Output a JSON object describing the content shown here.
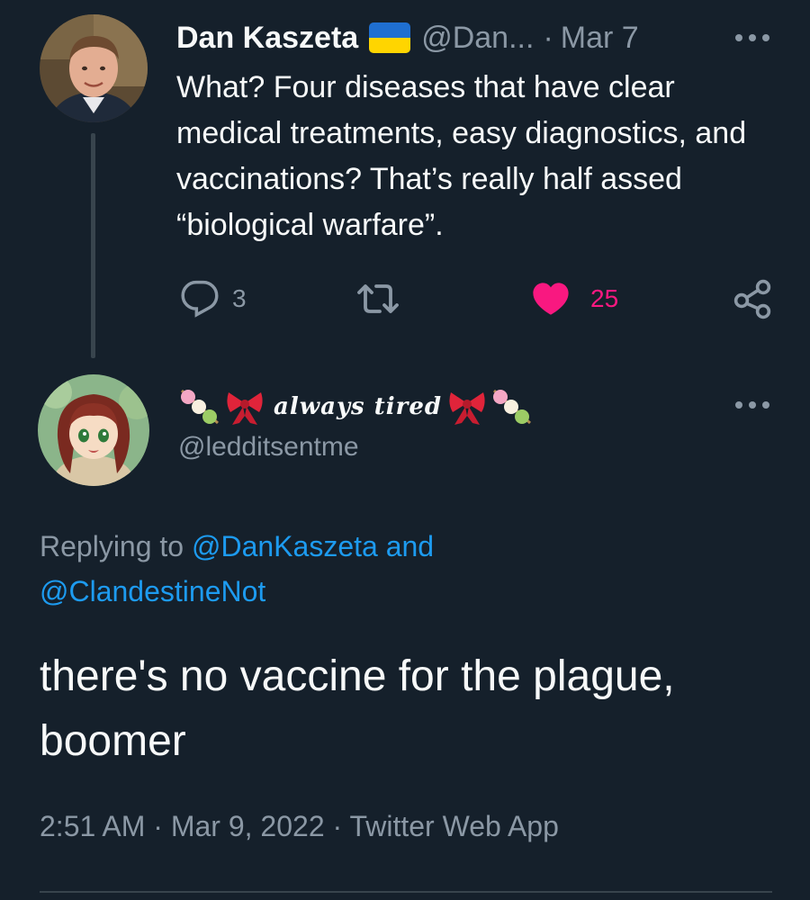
{
  "parent_tweet": {
    "author_name": "Dan Kaszeta",
    "flag_icon": "ukraine-flag-icon",
    "handle": "@Dan...",
    "separator": "·",
    "date": "Mar 7",
    "text": "What? Four diseases that have clear medical treatments, easy diagnostics, and vaccinations? That’s really half assed “biological warfare”.",
    "actions": {
      "reply_count": "3",
      "retweet_count": "",
      "like_count": "25",
      "liked": true
    }
  },
  "reply_tweet": {
    "display_name": "always tired",
    "handle": "@ledditsentme",
    "replying_prefix": "Replying to",
    "replying_mention_1": "@DanKaszeta",
    "replying_and": "and",
    "replying_mention_2": "@ClandestineNot",
    "text": "there's no vaccine for the plague, boomer",
    "time": "2:51 AM",
    "meta_sep_1": "·",
    "date": "Mar 9, 2022",
    "meta_sep_2": "·",
    "source": "Twitter Web App"
  },
  "colors": {
    "background": "#15202b",
    "text_primary": "#f7f9f9",
    "text_secondary": "#8b98a5",
    "link": "#1d9bf0",
    "like": "#f91880",
    "divider": "#38444d"
  }
}
